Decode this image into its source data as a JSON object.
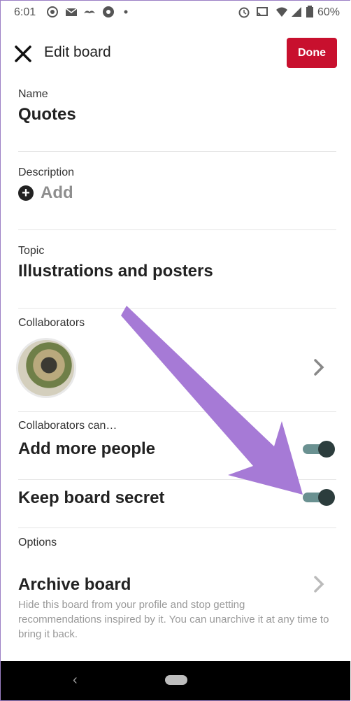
{
  "status_bar": {
    "time": "6:01",
    "battery": "60%"
  },
  "header": {
    "title": "Edit board",
    "done_label": "Done"
  },
  "name": {
    "label": "Name",
    "value": "Quotes"
  },
  "description": {
    "label": "Description",
    "add_label": "Add"
  },
  "topic": {
    "label": "Topic",
    "value": "Illustrations and posters"
  },
  "collaborators": {
    "label": "Collaborators"
  },
  "permissions": {
    "label": "Collaborators can…",
    "add_more_people": {
      "label": "Add more people",
      "on": true
    },
    "keep_secret": {
      "label": "Keep board secret",
      "on": true
    }
  },
  "options": {
    "label": "Options",
    "archive_title": "Archive board",
    "archive_help": "Hide this board from your profile and stop getting recommendations inspired by it. You can unarchive it at any time to bring it back."
  },
  "colors": {
    "done_button": "#c8102e",
    "annotation_arrow": "#a67ad6",
    "toggle_knob": "#2c3d3d",
    "toggle_track": "#6a9191"
  }
}
